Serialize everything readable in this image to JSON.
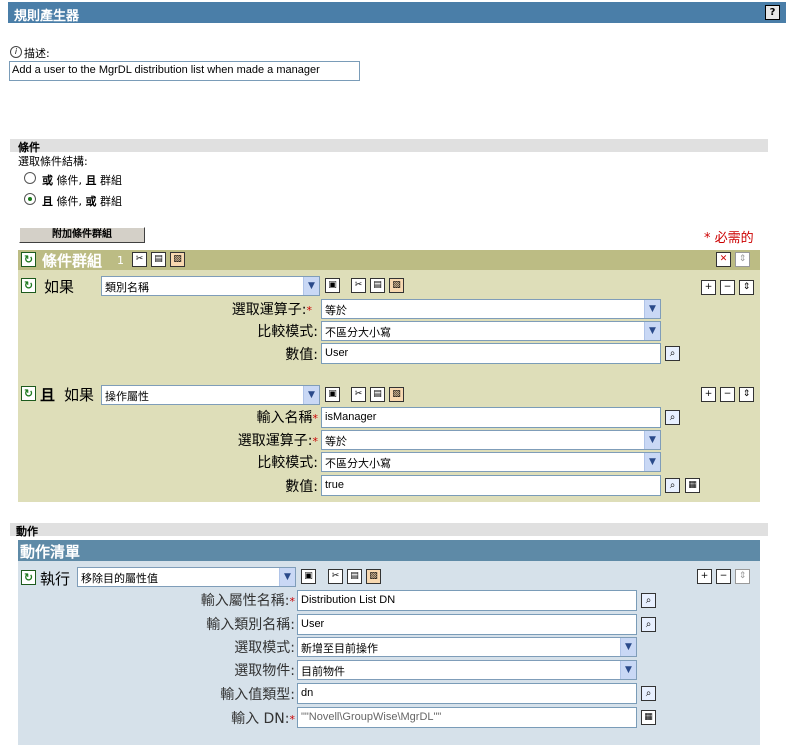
{
  "title": "規則產生器",
  "help_label": "?",
  "description": {
    "label": "描述:",
    "value": "Add a user to the MgrDL distribution list when made a manager"
  },
  "conditions": {
    "section_label": "條件",
    "structure_label": "選取條件結構:",
    "options": [
      {
        "bold": "或",
        "rest": " 條件, ",
        "bold2": "且",
        "rest2": " 群組",
        "selected": false
      },
      {
        "bold": "且",
        "rest": " 條件, ",
        "bold2": "或",
        "rest2": " 群組",
        "selected": true
      }
    ],
    "append_button": "附加條件群組",
    "required_note": "* 必需的",
    "group": {
      "title": "條件群組",
      "number": "1",
      "cond1": {
        "prefix": "如果",
        "type": "類別名稱",
        "operator_label": "選取運算子:",
        "operator": "等於",
        "mode_label": "比較模式:",
        "mode": "不區分大小寫",
        "value_label": "數值:",
        "value": "User"
      },
      "cond2": {
        "prefix_and": "且",
        "prefix": "如果",
        "type": "操作屬性",
        "name_label": "輸入名稱",
        "name": "isManager",
        "operator_label": "選取運算子:",
        "operator": "等於",
        "mode_label": "比較模式:",
        "mode": "不區分大小寫",
        "value_label": "數值:",
        "value": "true"
      }
    }
  },
  "actions": {
    "section_label": "動作",
    "list_title": "動作清單",
    "do_label": "執行",
    "action_type": "移除目的屬性值",
    "attr_name_label": "輸入屬性名稱:",
    "attr_name": "Distribution List DN",
    "class_name_label": "輸入類別名稱:",
    "class_name": "User",
    "mode_label": "選取模式:",
    "mode": "新增至目前操作",
    "object_label": "選取物件:",
    "object": "目前物件",
    "value_type_label": "輸入值類型:",
    "value_type": "dn",
    "dn_label": "輸入 DN:",
    "dn": "\"\"Novell\\GroupWise\\MgrDL\"\""
  }
}
